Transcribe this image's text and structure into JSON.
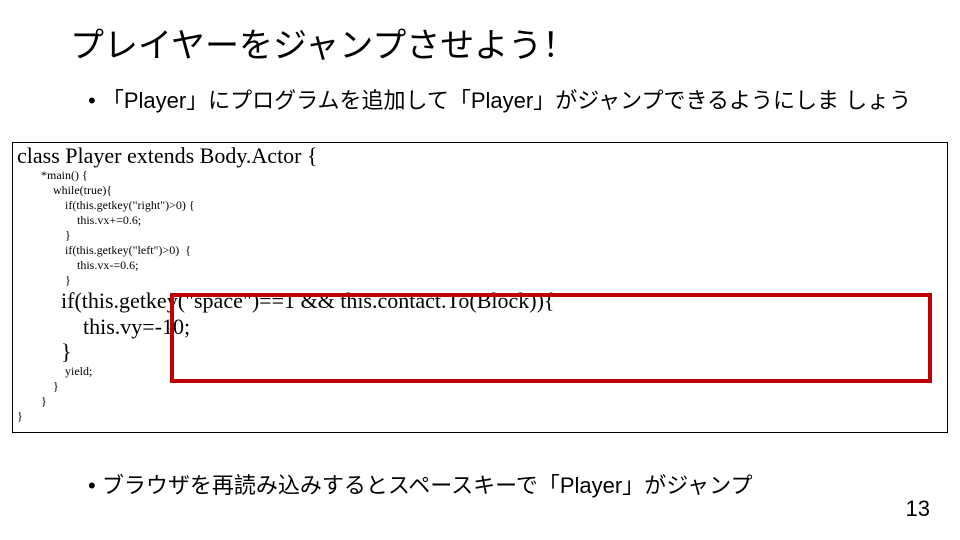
{
  "title": "プレイヤーをジャンプさせよう！",
  "bullet1": "• 「Player」にプログラムを追加して「Player」がジャンプできるようにしま\n  しょう",
  "code": {
    "l1": "class Player extends Body.Actor {",
    "l2": "        *main() {",
    "l3": "            while(true){",
    "l4": "                if(this.getkey(\"right\")>0) {",
    "l5": "                    this.vx+=0.6;",
    "l6": "                }",
    "l7": "                if(this.getkey(\"left\")>0)  {",
    "l8": "                    this.vx-=0.6;",
    "l9": "                }",
    "h1": "        if(this.getkey(\"space\")==1 && this.contact.To(Block)){",
    "h2": "            this.vy=-10;",
    "h3": "        }",
    "l10": "                yield;",
    "l11": "            }",
    "l12": "        }",
    "l13": "}"
  },
  "bullet2": "• ブラウザを再読み込みするとスペースキーで「Player」がジャンプ",
  "pagenum": "13"
}
